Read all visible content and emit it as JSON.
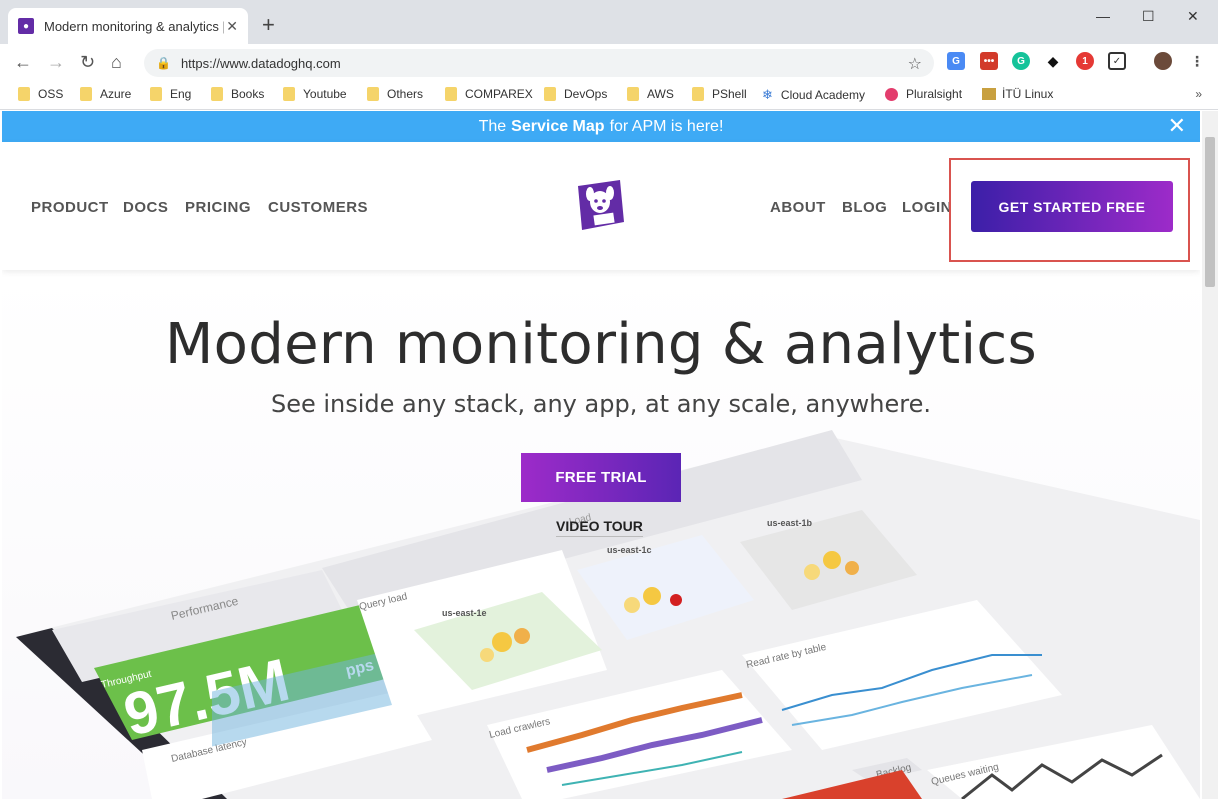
{
  "browser": {
    "tab_title": "Modern monitoring & analytics | ",
    "url": "https://www.datadoghq.com",
    "bookmarks": [
      {
        "label": "OSS",
        "icon": "folder-icon"
      },
      {
        "label": "Azure",
        "icon": "folder-icon"
      },
      {
        "label": "Eng",
        "icon": "folder-icon"
      },
      {
        "label": "Books",
        "icon": "folder-icon"
      },
      {
        "label": "Youtube",
        "icon": "folder-icon"
      },
      {
        "label": "Others",
        "icon": "folder-icon"
      },
      {
        "label": "COMPAREX",
        "icon": "folder-icon"
      },
      {
        "label": "DevOps",
        "icon": "folder-icon"
      },
      {
        "label": "AWS",
        "icon": "folder-icon"
      },
      {
        "label": "PShell",
        "icon": "folder-icon"
      },
      {
        "label": "Cloud Academy",
        "icon": "cloud-academy-icon"
      },
      {
        "label": "Pluralsight",
        "icon": "pluralsight-icon"
      },
      {
        "label": "İTÜ Linux",
        "icon": "itu-icon"
      }
    ],
    "extension_badge": "1"
  },
  "banner": {
    "prefix": "The",
    "bold": "Service Map",
    "suffix": "for APM is here!"
  },
  "nav": {
    "left": [
      "PRODUCT",
      "DOCS",
      "PRICING",
      "CUSTOMERS"
    ],
    "right": [
      "ABOUT",
      "BLOG",
      "LOGIN"
    ],
    "cta": "GET STARTED FREE"
  },
  "hero": {
    "title": "Modern monitoring & analytics",
    "subtitle": "See inside any stack, any app, at any scale, anywhere.",
    "trial": "FREE TRIAL",
    "tour": "VIDEO TOUR"
  },
  "dashboard": {
    "performance": "Performance",
    "throughput_label": "Throughput",
    "throughput_value": "97.5M",
    "throughput_unit": "pps",
    "query_load": "Query load",
    "load": "Load",
    "db_latency": "Database latency",
    "load_crawlers": "Load crawlers",
    "read_rate": "Read rate by table",
    "backlog": "Backlog",
    "queues": "Queues waiting",
    "zones": [
      "us-east-1e",
      "us-east-1c",
      "us-east-1b"
    ]
  },
  "colors": {
    "banner": "#3eaaf5",
    "brand": "#632ca6",
    "cta_start": "#3b1fa8",
    "cta_end": "#9d2bc9",
    "highlight": "#d9534f",
    "throughput": "#6cc04a"
  }
}
